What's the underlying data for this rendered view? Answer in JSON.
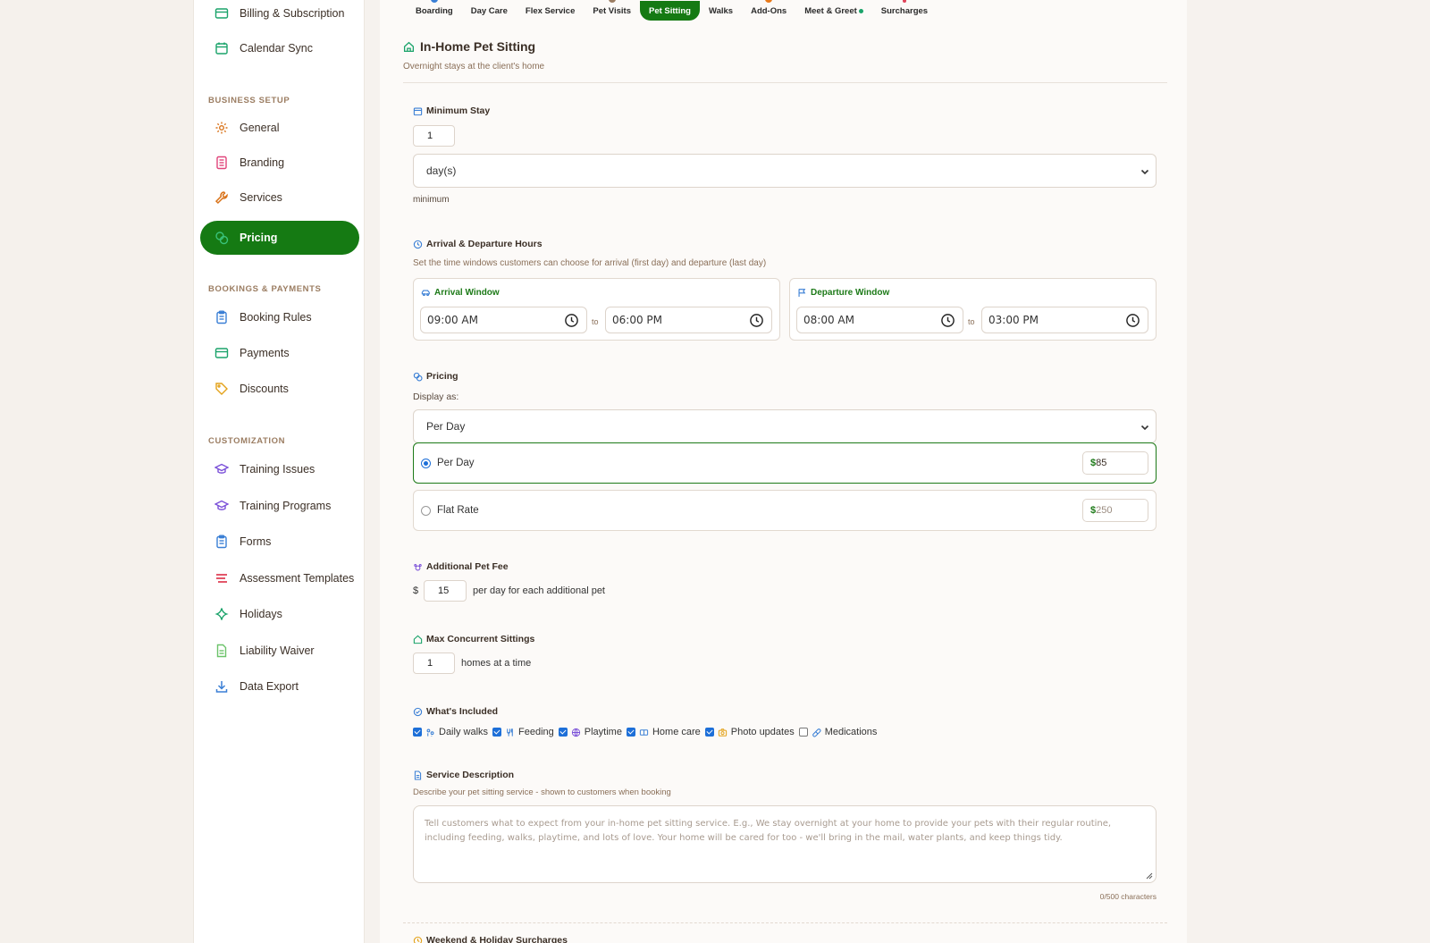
{
  "sidebar": {
    "items_top": [
      {
        "label": "Billing & Subscription",
        "icon": "credit-card-icon"
      },
      {
        "label": "Calendar Sync",
        "icon": "calendar-icon"
      }
    ],
    "section_business": "BUSINESS SETUP",
    "items_business": [
      {
        "label": "General",
        "icon": "gear-icon"
      },
      {
        "label": "Branding",
        "icon": "palette-icon"
      },
      {
        "label": "Services",
        "icon": "wrench-icon"
      },
      {
        "label": "Pricing",
        "icon": "coins-icon",
        "active": true
      }
    ],
    "section_bookings": "BOOKINGS & PAYMENTS",
    "items_bookings": [
      {
        "label": "Booking Rules",
        "icon": "clipboard-icon"
      },
      {
        "label": "Payments",
        "icon": "credit-card-icon"
      },
      {
        "label": "Discounts",
        "icon": "tag-icon"
      }
    ],
    "section_custom": "CUSTOMIZATION",
    "items_custom": [
      {
        "label": "Training Issues",
        "icon": "graduation-cap-icon"
      },
      {
        "label": "Training Programs",
        "icon": "graduation-cap-icon"
      },
      {
        "label": "Forms",
        "icon": "clipboard-icon"
      },
      {
        "label": "Assessment Templates",
        "icon": "list-icon"
      },
      {
        "label": "Holidays",
        "icon": "sparkle-icon"
      },
      {
        "label": "Liability Waiver",
        "icon": "document-icon"
      },
      {
        "label": "Data Export",
        "icon": "download-icon"
      }
    ]
  },
  "tabs": [
    "Boarding",
    "Day Care",
    "Flex Service",
    "Pet Visits",
    "Pet Sitting",
    "Walks",
    "Add-Ons",
    "Meet & Greet",
    "Surcharges"
  ],
  "active_tab": "Pet Sitting",
  "header": {
    "title": "In-Home Pet Sitting",
    "subtitle": "Overnight stays at the client's home"
  },
  "minimum_stay": {
    "label": "Minimum Stay",
    "value": "1",
    "unit": "day(s)",
    "hint": "minimum"
  },
  "hours": {
    "label": "Arrival & Departure Hours",
    "hint": "Set the time windows customers can choose for arrival (first day) and departure (last day)",
    "arrival": {
      "title": "Arrival Window",
      "from": "09:00 AM",
      "to": "06:00 PM"
    },
    "departure": {
      "title": "Departure Window",
      "from": "08:00 AM",
      "to": "03:00 PM"
    },
    "to_label": "to"
  },
  "pricing": {
    "label": "Pricing",
    "display_as_label": "Display as:",
    "display_as": "Per Day",
    "options": [
      {
        "label": "Per Day",
        "currency": "$",
        "value": "85",
        "selected": true
      },
      {
        "label": "Flat Rate",
        "currency": "$",
        "value": "250",
        "selected": false
      }
    ]
  },
  "additional_pet_fee": {
    "label": "Additional Pet Fee",
    "currency": "$",
    "value": "15",
    "suffix": "per day for each additional pet"
  },
  "max_concurrent": {
    "label": "Max Concurrent Sittings",
    "value": "1",
    "suffix": "homes at a time"
  },
  "included": {
    "label": "What's Included",
    "items": [
      {
        "label": "Daily walks",
        "checked": true,
        "icon": "paw-icon"
      },
      {
        "label": "Feeding",
        "checked": true,
        "icon": "utensils-icon"
      },
      {
        "label": "Playtime",
        "checked": true,
        "icon": "globe-icon"
      },
      {
        "label": "Home care",
        "checked": true,
        "icon": "home-icon"
      },
      {
        "label": "Photo updates",
        "checked": true,
        "icon": "camera-icon"
      },
      {
        "label": "Medications",
        "checked": false,
        "icon": "pill-icon"
      }
    ]
  },
  "description": {
    "label": "Service Description",
    "hint": "Describe your pet sitting service - shown to customers when booking",
    "placeholder": "Tell customers what to expect from your in-home pet sitting service. E.g., We stay overnight at your home to provide your pets with their regular routine, including feeding, walks, playtime, and lots of love. Your home will be cared for too - we'll bring in the mail, water plants, and keep things tidy.",
    "counter": "0/500 characters"
  },
  "next_section": "Weekend & Holiday Surcharges",
  "colors": {
    "accent": "#157a13",
    "radio": "#1d6fd8"
  }
}
